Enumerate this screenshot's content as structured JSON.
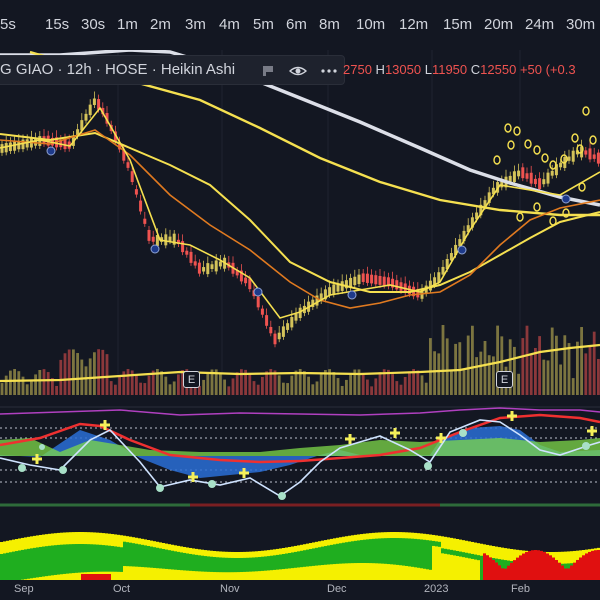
{
  "timeframes": [
    "5s",
    "15s",
    "30s",
    "1m",
    "2m",
    "3m",
    "4m",
    "5m",
    "6m",
    "8m",
    "10m",
    "12m",
    "15m",
    "20m",
    "24m",
    "30m"
  ],
  "legend": {
    "symbol_text": "G GIAO · 12h · HOSE · Heikin Ashi",
    "o_prefix": "",
    "o_value": "2750",
    "h_label": "H",
    "h_value": "13050",
    "l_label": "L",
    "l_value": "11950",
    "c_label": "C",
    "c_value": "12550",
    "change": "+50 (+0.3",
    "icons": [
      "square-icon",
      "eye-icon",
      "more-icon"
    ]
  },
  "events": {
    "badge_label": "E"
  },
  "x_axis": [
    "Sep",
    "Oct",
    "Nov",
    "Dec",
    "2023",
    "Feb"
  ],
  "colors": {
    "up": "#d4c35a",
    "down": "#ef5350",
    "ma_yellow": "#f5e050",
    "ma_orange": "#e07a20",
    "ma_white": "#dcdfe8",
    "osc_blue": "#2a6fd6",
    "osc_green": "#7fd94a",
    "bg": "#131722"
  }
}
